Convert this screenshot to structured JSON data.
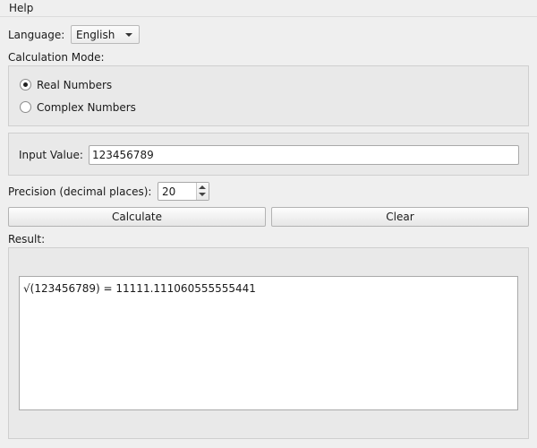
{
  "menu": {
    "help": "Help"
  },
  "language": {
    "label": "Language:",
    "selected": "English"
  },
  "calculation_mode": {
    "label": "Calculation Mode:",
    "options": [
      {
        "label": "Real Numbers",
        "checked": true
      },
      {
        "label": "Complex Numbers",
        "checked": false
      }
    ]
  },
  "input": {
    "label": "Input Value:",
    "value": "123456789"
  },
  "precision": {
    "label": "Precision (decimal places):",
    "value": "20"
  },
  "buttons": {
    "calculate": "Calculate",
    "clear": "Clear"
  },
  "result": {
    "label": "Result:",
    "text": "√(123456789) = 11111.111060555555441"
  }
}
